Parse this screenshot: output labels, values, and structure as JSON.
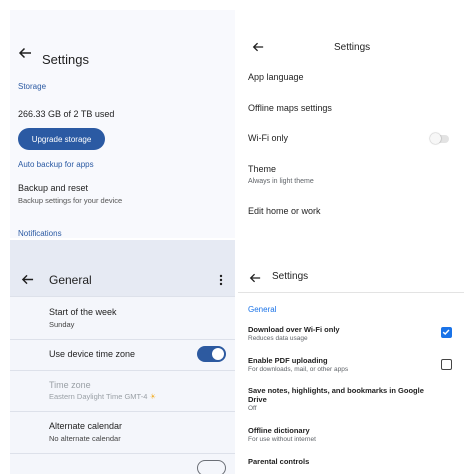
{
  "drive": {
    "title": "Settings",
    "storage_section": "Storage",
    "storage_used": "266.33 GB of 2 TB used",
    "upgrade_button": "Upgrade storage",
    "backup_section": "Auto backup for apps",
    "backup_title": "Backup and reset",
    "backup_subtitle": "Backup settings for your device",
    "notifications_section": "Notifications",
    "accent_color": "#2b5aa3"
  },
  "maps": {
    "title": "Settings",
    "items": [
      {
        "label": "App language"
      },
      {
        "label": "Offline maps settings"
      },
      {
        "label": "Wi-Fi only"
      },
      {
        "label": "Theme",
        "sub": "Always in light theme"
      },
      {
        "label": "Edit home or work"
      }
    ],
    "wifi_only_enabled": false
  },
  "calendar": {
    "title": "General",
    "start_week_label": "Start of the week",
    "start_week_value": "Sunday",
    "device_tz_label": "Use device time zone",
    "device_tz_enabled": true,
    "time_zone_label": "Time zone",
    "time_zone_value": "Eastern Daylight Time  GMT-4",
    "alt_calendar_label": "Alternate calendar",
    "alt_calendar_value": "No alternate calendar",
    "accent_color": "#2d5aa0"
  },
  "books": {
    "title": "Settings",
    "section": "General",
    "items": [
      {
        "label": "Download over Wi-Fi only",
        "sub": "Reduces data usage",
        "checked": true
      },
      {
        "label": "Enable PDF uploading",
        "sub": "For downloads, mail, or other apps",
        "checked": false
      },
      {
        "label": "Save notes, highlights, and bookmarks in Google Drive",
        "sub": "Off"
      },
      {
        "label": "Offline dictionary",
        "sub": "For use without internet"
      },
      {
        "label": "Parental controls"
      }
    ],
    "accent_color": "#1a73e8"
  }
}
